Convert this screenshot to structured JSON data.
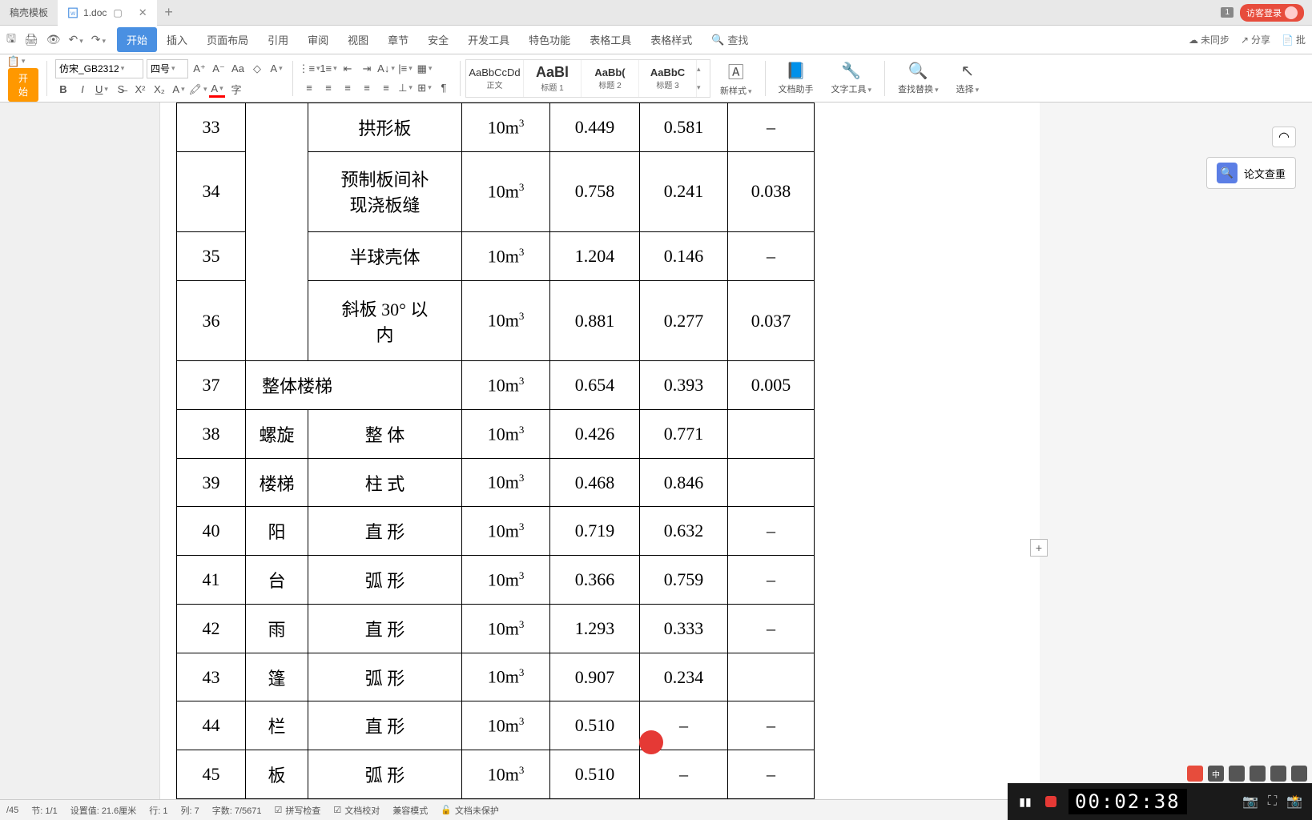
{
  "tabs": {
    "tpl": "稿壳模板",
    "doc": "1.doc"
  },
  "titlebar": {
    "notif": "1",
    "login": "访客登录"
  },
  "menu": {
    "start": "开始",
    "insert": "插入",
    "layout": "页面布局",
    "ref": "引用",
    "review": "审阅",
    "view": "视图",
    "chapter": "章节",
    "security": "安全",
    "dev": "开发工具",
    "special": "特色功能",
    "tabletool": "表格工具",
    "tablestyle": "表格样式",
    "search": "查找",
    "unsync": "未同步",
    "share": "分享",
    "batch": "批"
  },
  "ribbon": {
    "start_btn": "开始",
    "font_name": "仿宋_GB2312",
    "font_size": "四号",
    "styles": {
      "body_prev": "AaBbCcDd",
      "body": "正文",
      "h1_prev": "AaBl",
      "h1": "标题 1",
      "h2_prev": "AaBb(",
      "h2": "标题 2",
      "h3_prev": "AaBbC",
      "h3": "标题 3"
    },
    "newstyle": "新样式",
    "dochelper": "文档助手",
    "texttool": "文字工具",
    "findreplace": "查找替换",
    "select": "选择"
  },
  "rightpanel": {
    "papercheck": "论文查重"
  },
  "table": {
    "rows": [
      {
        "idx": "33",
        "cat": "",
        "name": "拱形板",
        "unit": "10m",
        "sup": "3",
        "v1": "0.449",
        "v2": "0.581",
        "v3": "–"
      },
      {
        "idx": "34",
        "cat": "",
        "name": "预制板间补\n现浇板缝",
        "unit": "10m",
        "sup": "3",
        "v1": "0.758",
        "v2": "0.241",
        "v3": "0.038"
      },
      {
        "idx": "35",
        "cat": "",
        "name": "半球壳体",
        "unit": "10m",
        "sup": "3",
        "v1": "1.204",
        "v2": "0.146",
        "v3": "–"
      },
      {
        "idx": "36",
        "cat": "",
        "name": "斜板 30° 以\n内",
        "unit": "10m",
        "sup": "3",
        "v1": "0.881",
        "v2": "0.277",
        "v3": "0.037"
      },
      {
        "idx": "37",
        "cat": "整体楼梯",
        "name": "",
        "unit": "10m",
        "sup": "3",
        "v1": "0.654",
        "v2": "0.393",
        "v3": "0.005"
      },
      {
        "idx": "38",
        "cat": "螺旋",
        "name": "整 体",
        "unit": "10m",
        "sup": "3",
        "v1": "0.426",
        "v2": "0.771",
        "v3": ""
      },
      {
        "idx": "39",
        "cat": "楼梯",
        "name": "柱 式",
        "unit": "10m",
        "sup": "3",
        "v1": "0.468",
        "v2": "0.846",
        "v3": ""
      },
      {
        "idx": "40",
        "cat": "阳",
        "name": "直 形",
        "unit": "10m",
        "sup": "3",
        "v1": "0.719",
        "v2": "0.632",
        "v3": "–"
      },
      {
        "idx": "41",
        "cat": "台",
        "name": "弧 形",
        "unit": "10m",
        "sup": "3",
        "v1": "0.366",
        "v2": "0.759",
        "v3": "–"
      },
      {
        "idx": "42",
        "cat": "雨",
        "name": "直 形",
        "unit": "10m",
        "sup": "3",
        "v1": "1.293",
        "v2": "0.333",
        "v3": "–"
      },
      {
        "idx": "43",
        "cat": "篷",
        "name": "弧 形",
        "unit": "10m",
        "sup": "3",
        "v1": "0.907",
        "v2": "0.234",
        "v3": ""
      },
      {
        "idx": "44",
        "cat": "栏",
        "name": "直 形",
        "unit": "10m",
        "sup": "3",
        "v1": "0.510",
        "v2": "–",
        "v3": "–"
      },
      {
        "idx": "45",
        "cat": "板",
        "name": "弧 形",
        "unit": "10m",
        "sup": "3",
        "v1": "0.510",
        "v2": "–",
        "v3": "–"
      }
    ]
  },
  "status": {
    "page": "/45",
    "section": "节: 1/1",
    "setval": "设置值: 21.6厘米",
    "row": "行: 1",
    "col": "列: 7",
    "words": "字数: 7/5671",
    "spell": "拼写检查",
    "proof": "文档校对",
    "compat": "兼容模式",
    "unprotect": "文档未保护"
  },
  "recording": {
    "time": "00:02:38"
  }
}
